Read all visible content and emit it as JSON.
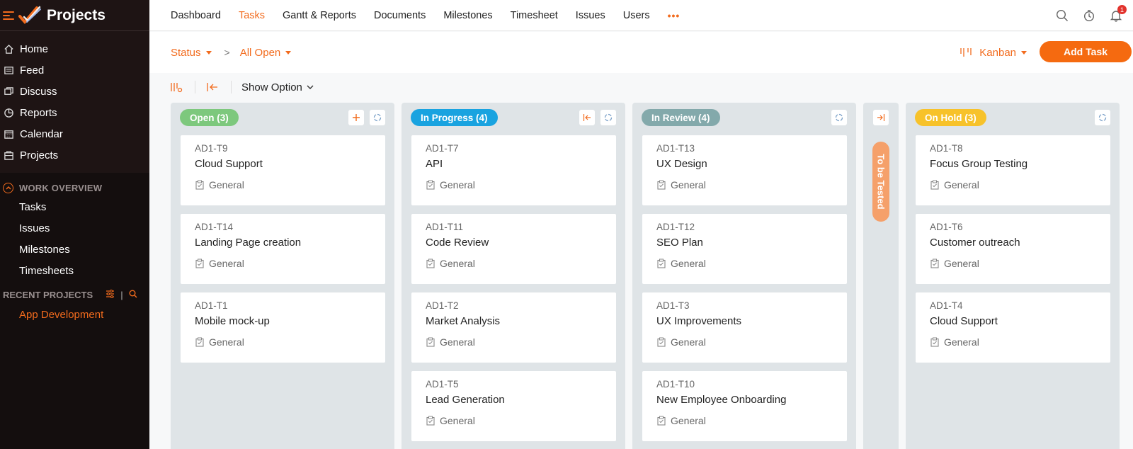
{
  "app": {
    "title": "Projects"
  },
  "sidebar": {
    "nav": [
      {
        "label": "Home",
        "icon": "home-icon"
      },
      {
        "label": "Feed",
        "icon": "feed-icon"
      },
      {
        "label": "Discuss",
        "icon": "discuss-icon"
      },
      {
        "label": "Reports",
        "icon": "reports-icon"
      },
      {
        "label": "Calendar",
        "icon": "calendar-icon"
      },
      {
        "label": "Projects",
        "icon": "projects-icon"
      }
    ],
    "work_overview": {
      "title": "WORK OVERVIEW",
      "items": [
        "Tasks",
        "Issues",
        "Milestones",
        "Timesheets"
      ]
    },
    "recent": {
      "title": "RECENT PROJECTS",
      "sep": "|",
      "items": [
        "App Development"
      ]
    }
  },
  "topnav": {
    "tabs": [
      "Dashboard",
      "Tasks",
      "Gantt & Reports",
      "Documents",
      "Milestones",
      "Timesheet",
      "Issues",
      "Users"
    ],
    "active": "Tasks",
    "more": "•••",
    "notification_count": "1"
  },
  "filters": {
    "status_label": "Status",
    "separator": ">",
    "view_filter": "All Open",
    "view_mode": "Kanban",
    "add_task_label": "Add Task"
  },
  "toolbar": {
    "show_option_label": "Show Option"
  },
  "colors": {
    "accent": "#f26b1d",
    "open": "#7dc87d",
    "in_progress": "#19a3e0",
    "in_review": "#83a9ab",
    "to_be_tested": "#f5a06a",
    "on_hold": "#f7c22a"
  },
  "board": {
    "columns": [
      {
        "title": "Open (3)",
        "color": "#7dc87d",
        "cards": [
          {
            "id": "AD1-T9",
            "name": "Cloud Support",
            "tag": "General"
          },
          {
            "id": "AD1-T14",
            "name": "Landing Page creation",
            "tag": "General"
          },
          {
            "id": "AD1-T1",
            "name": "Mobile mock-up",
            "tag": "General"
          }
        ]
      },
      {
        "title": "In Progress (4)",
        "color": "#19a3e0",
        "cards": [
          {
            "id": "AD1-T7",
            "name": "API",
            "tag": "General"
          },
          {
            "id": "AD1-T11",
            "name": "Code Review",
            "tag": "General"
          },
          {
            "id": "AD1-T2",
            "name": "Market Analysis",
            "tag": "General"
          },
          {
            "id": "AD1-T5",
            "name": "Lead Generation",
            "tag": "General"
          }
        ]
      },
      {
        "title": "In Review (4)",
        "color": "#83a9ab",
        "cards": [
          {
            "id": "AD1-T13",
            "name": "UX Design",
            "tag": "General"
          },
          {
            "id": "AD1-T12",
            "name": "SEO Plan",
            "tag": "General"
          },
          {
            "id": "AD1-T3",
            "name": "UX Improvements",
            "tag": "General"
          },
          {
            "id": "AD1-T10",
            "name": "New Employee Onboarding",
            "tag": "General"
          }
        ]
      },
      {
        "title": "To be Tested",
        "collapsed": true,
        "color": "#f5a06a"
      },
      {
        "title": "On Hold (3)",
        "color": "#f7c22a",
        "cards": [
          {
            "id": "AD1-T8",
            "name": "Focus Group Testing",
            "tag": "General"
          },
          {
            "id": "AD1-T6",
            "name": "Customer outreach",
            "tag": "General"
          },
          {
            "id": "AD1-T4",
            "name": "Cloud Support",
            "tag": "General"
          }
        ]
      }
    ]
  }
}
